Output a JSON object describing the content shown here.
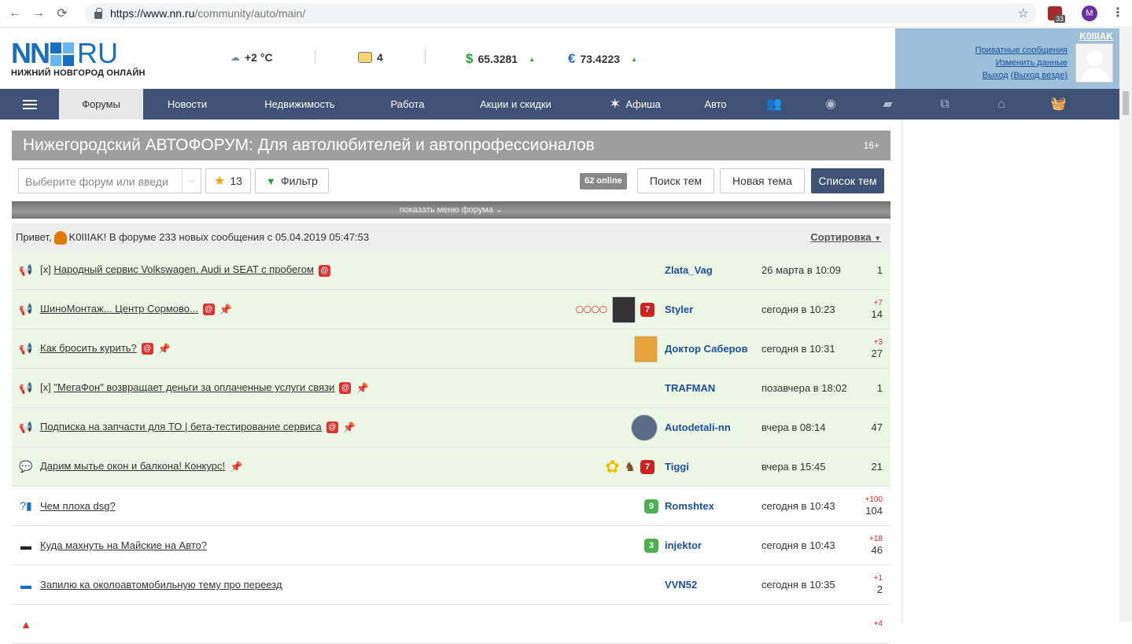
{
  "browser": {
    "url_domain": "https://www.nn.ru",
    "url_path": "/community/auto/main/",
    "extension_badge": "33",
    "profile_initial": "M"
  },
  "header": {
    "logo_left": "NN",
    "logo_right": "RU",
    "tagline": "НИЖНИЙ НОВГОРОД ОНЛАЙН",
    "weather": "+2 °C",
    "traffic": "4",
    "usd_sign": "$",
    "usd": "65.3281",
    "eur_sign": "€",
    "eur": "73.4223"
  },
  "user": {
    "name": "K0IIIAK",
    "private_messages": "Приватные сообщения",
    "edit_profile": "Изменить данные",
    "logout": "Выход",
    "logout_everywhere": "(Выход везде)"
  },
  "nav": {
    "items": [
      "Форумы",
      "Новости",
      "Недвижимость",
      "Работа",
      "Акции и скидки",
      "Афиша",
      "Авто"
    ]
  },
  "forum": {
    "title": "Нижегородский АВТОФОРУМ: Для автолюбителей и автопрофессионалов",
    "age": "16+",
    "select_placeholder": "Выберите форум или введи",
    "favorites_count": "13",
    "filter_label": "Фильтр",
    "online": "62 online",
    "search_label": "Поиск тем",
    "new_topic_label": "Новая тема",
    "topic_list_label": "Список тем",
    "show_menu": "показать меню форума",
    "greeting_prefix": "Привет,",
    "greeting_rest": "K0IIIAK! В форуме 233 новых сообщения с 05.04.2019 05:47:53",
    "sort_label": "Сортировка"
  },
  "topics": [
    {
      "prefix": "[x] ",
      "title": "Народный сервис Volkswagen, Audi и SEAT с пробегом",
      "at": true,
      "pin": false,
      "author": "Zlata_Vag",
      "date": "26 марта в 10:09",
      "new": "",
      "count": "1"
    },
    {
      "prefix": "",
      "title": "ШиноМонтаж... Центр Сормово...",
      "at": true,
      "pin": true,
      "author": "Styler",
      "date": "сегодня в 10:23",
      "new": "+7",
      "count": "14"
    },
    {
      "prefix": "",
      "title": "Как бросить курить?",
      "at": true,
      "pin": true,
      "author": "Доктор Саберов",
      "date": "сегодня в 10:31",
      "new": "+3",
      "count": "27"
    },
    {
      "prefix": "[x] ",
      "title": "\"МегаФон\" возвращает деньги за оплаченные услуги связи",
      "at": true,
      "pin": true,
      "author": "TRAFMAN",
      "date": "позавчера в 18:02",
      "new": "",
      "count": "1"
    },
    {
      "prefix": "",
      "title": "Подписка на запчасти для ТО | бета-тестирование сервиса",
      "at": true,
      "pin": true,
      "author": "Autodetali-nn",
      "date": "вчера в 08:14",
      "new": "",
      "count": "47"
    },
    {
      "prefix": "",
      "title": "Дарим мытье окон и балкона! Конкурс!",
      "at": false,
      "pin": true,
      "author": "Tiggi",
      "date": "вчера в 15:45",
      "new": "",
      "count": "21"
    },
    {
      "prefix": "",
      "title": "Чем плоха dsg?",
      "at": false,
      "pin": false,
      "author": "Romshtex",
      "date": "сегодня в 10:43",
      "new": "+100",
      "count": "104"
    },
    {
      "prefix": "",
      "title": "Куда махнуть на Майские на Авто?",
      "at": false,
      "pin": false,
      "author": "injektor",
      "date": "сегодня в 10:43",
      "new": "+18",
      "count": "46"
    },
    {
      "prefix": "",
      "title": "Запилю ка околоавтомобильную тему про переезд",
      "at": false,
      "pin": false,
      "author": "VVN52",
      "date": "сегодня в 10:35",
      "new": "+1",
      "count": "2"
    },
    {
      "prefix": "",
      "title": "",
      "at": false,
      "pin": false,
      "author": "",
      "date": "",
      "new": "+4",
      "count": ""
    }
  ],
  "level_badges": {
    "styler": "7",
    "tiggi": "7",
    "romshtex": "9",
    "injektor": "3"
  }
}
